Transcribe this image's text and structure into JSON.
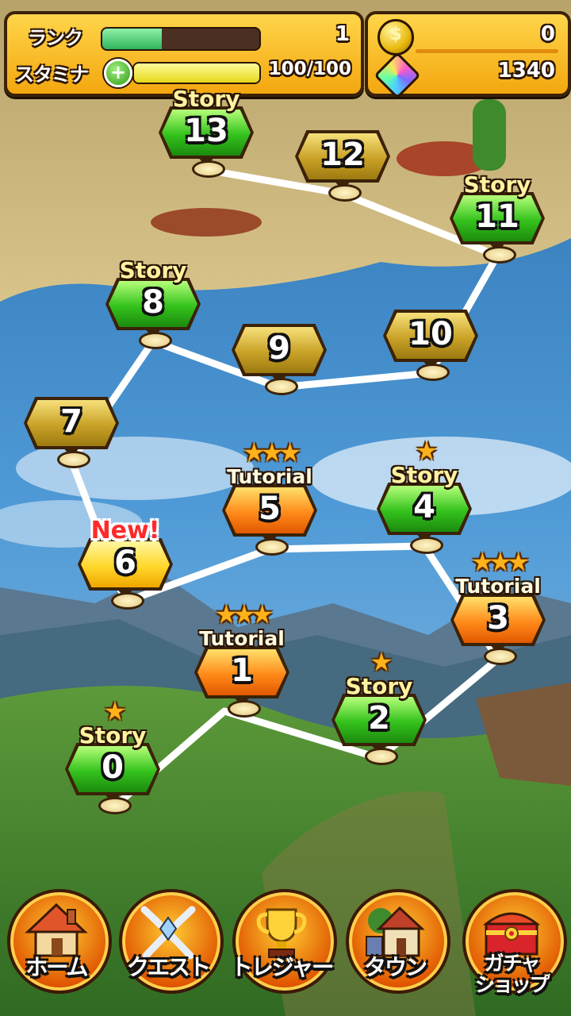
{
  "hud": {
    "rank_label": "ランク",
    "rank_value": "1",
    "rank_progress": 0.38,
    "stamina_label": "スタミナ",
    "stamina_value": "100/100",
    "stamina_progress": 1.0,
    "plus_symbol": "+",
    "coins": "0",
    "gems": "1340"
  },
  "icons": {
    "coin": "coin-icon",
    "gem": "rainbow-gem-icon",
    "star": "★"
  },
  "stages": [
    {
      "id": "0",
      "number": "0",
      "tag": "Story",
      "type": "story",
      "stars": "★"
    },
    {
      "id": "1",
      "number": "1",
      "tag": "Tutorial",
      "type": "tutorial",
      "stars": "★★★"
    },
    {
      "id": "2",
      "number": "2",
      "tag": "Story",
      "type": "story",
      "stars": "★"
    },
    {
      "id": "3",
      "number": "3",
      "tag": "Tutorial",
      "type": "tutorial",
      "stars": "★★★"
    },
    {
      "id": "4",
      "number": "4",
      "tag": "Story",
      "type": "story",
      "stars": "★"
    },
    {
      "id": "5",
      "number": "5",
      "tag": "Tutorial",
      "type": "tutorial",
      "stars": "★★★"
    },
    {
      "id": "6",
      "number": "6",
      "tag": "New!",
      "type": "new",
      "stars": ""
    },
    {
      "id": "7",
      "number": "7",
      "tag": "",
      "type": "locked",
      "stars": ""
    },
    {
      "id": "8",
      "number": "8",
      "tag": "Story",
      "type": "story",
      "stars": ""
    },
    {
      "id": "9",
      "number": "9",
      "tag": "",
      "type": "locked",
      "stars": ""
    },
    {
      "id": "10",
      "number": "10",
      "tag": "",
      "type": "locked",
      "stars": ""
    },
    {
      "id": "11",
      "number": "11",
      "tag": "Story",
      "type": "story",
      "stars": ""
    },
    {
      "id": "12",
      "number": "12",
      "tag": "",
      "type": "locked",
      "stars": ""
    },
    {
      "id": "13",
      "number": "13",
      "tag": "Story",
      "type": "story",
      "stars": ""
    }
  ],
  "nav": {
    "home": "ホーム",
    "quest": "クエスト",
    "treasure": "トレジャー",
    "town": "タウン",
    "gacha_line1": "ガチャ",
    "gacha_line2": "ショップ"
  },
  "colors": {
    "story": "#34c21c",
    "tutorial": "#ff8a1a",
    "locked": "#c9a227",
    "new": "#ffd72a",
    "rank_bar": "#4cd07a",
    "stamina_bar": "#f2ea2a"
  }
}
